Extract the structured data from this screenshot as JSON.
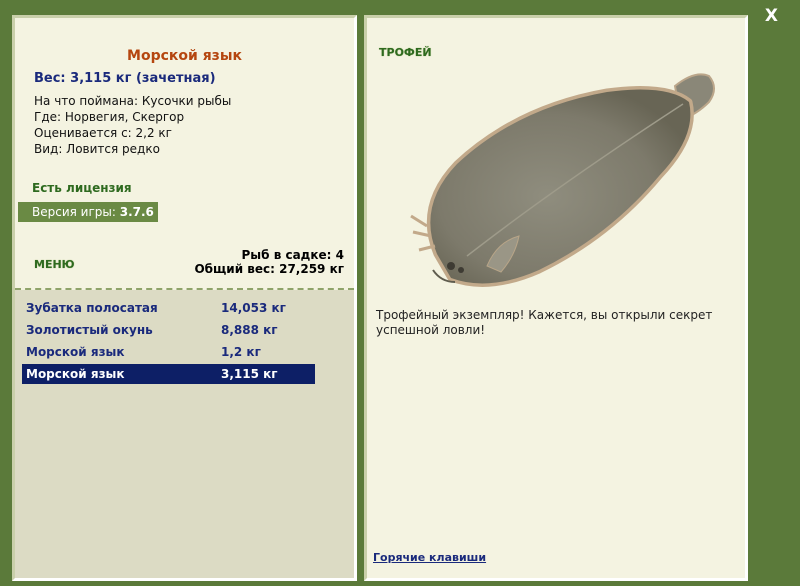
{
  "close_label": "X",
  "fish": {
    "title": "Морской язык",
    "weight_line": "Вес: 3,115 кг (зачетная)",
    "info": [
      "На что поймана: Кусочки рыбы",
      "Где: Норвегия, Скергор",
      "Оценивается с: 2,2 кг",
      "Вид: Ловится редко"
    ]
  },
  "license": "Есть лицензия",
  "version": {
    "label": "Версия игры: ",
    "value": "3.7.6"
  },
  "menu_label": "МЕНЮ",
  "stats": {
    "count": "Рыб в садке: 4",
    "total": "Общий вес: 27,259 кг"
  },
  "catch_list": [
    {
      "name": "Зубатка полосатая",
      "weight": "14,053 кг"
    },
    {
      "name": "Золотистый окунь",
      "weight": "8,888 кг"
    },
    {
      "name": "Морской язык",
      "weight": "1,2 кг"
    },
    {
      "name": "Морской язык",
      "weight": "3,115 кг"
    }
  ],
  "selected_index": 3,
  "trophy": {
    "label": "ТРОФЕЙ",
    "description": "Трофейный экземпляр! Кажется, вы открыли секрет успешной ловли!"
  },
  "hotkeys_label": "Горячие клавиши",
  "colors": {
    "frame": "#5b7a3a",
    "panel": "#f4f3e1",
    "title": "#b5460f",
    "accent_blue": "#1a2a7c",
    "selected_row": "#0d1f66",
    "green_text": "#2e6a1f"
  }
}
